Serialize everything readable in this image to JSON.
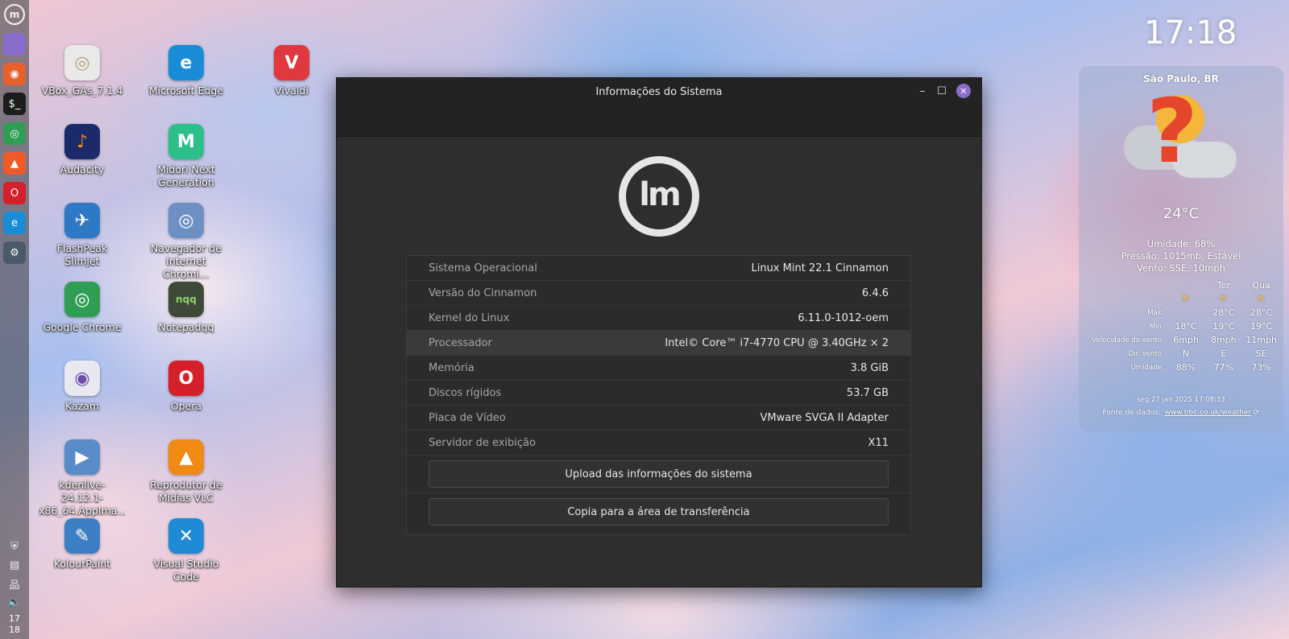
{
  "panel": {
    "apps": [
      {
        "name": "menu-button",
        "icon": "mint-menu-icon",
        "bg": "transparent",
        "glyph": "m"
      },
      {
        "name": "files-launcher",
        "icon": "folder-icon",
        "bg": "#8a6ccd",
        "glyph": ""
      },
      {
        "name": "firefox-launcher",
        "icon": "firefox-icon",
        "bg": "#e8612c",
        "glyph": "◉"
      },
      {
        "name": "terminal-launcher",
        "icon": "terminal-icon",
        "bg": "#1d1d1d",
        "glyph": "$_"
      },
      {
        "name": "chrome-launcher",
        "icon": "chrome-icon",
        "bg": "#2f9e54",
        "glyph": "◎"
      },
      {
        "name": "brave-launcher",
        "icon": "brave-icon",
        "bg": "#f05a28",
        "glyph": "▲"
      },
      {
        "name": "opera-launcher",
        "icon": "opera-icon",
        "bg": "#d51f2a",
        "glyph": "O"
      },
      {
        "name": "edge-launcher",
        "icon": "edge-icon",
        "bg": "#1a8bd6",
        "glyph": "e"
      },
      {
        "name": "settings-launcher",
        "icon": "gear-icon",
        "bg": "#4b5a6b",
        "glyph": "⚙"
      }
    ],
    "tray": [
      {
        "name": "shield-tray-icon",
        "glyph": "⛨"
      },
      {
        "name": "clipboard-tray-icon",
        "glyph": "▤"
      },
      {
        "name": "network-tray-icon",
        "glyph": "品"
      },
      {
        "name": "volume-tray-icon",
        "glyph": "🔈"
      }
    ],
    "clock_hour": "17",
    "clock_min": "18"
  },
  "desktop_icons": [
    {
      "label": "VBox_GAs_7.1.4",
      "icon": "disc-icon",
      "bg": "#e9e9e9",
      "color": "#b9a07a",
      "glyph": "◎"
    },
    {
      "label": "Microsoft Edge",
      "icon": "edge-icon",
      "bg": "#1a8bd6",
      "color": "#fff",
      "glyph": "e"
    },
    {
      "label": "Vivaldi",
      "icon": "vivaldi-icon",
      "bg": "#e0383e",
      "color": "#fff",
      "glyph": "V"
    },
    {
      "label": "Audacity",
      "icon": "audacity-icon",
      "bg": "#1b2a6b",
      "color": "#f28b1a",
      "glyph": "♪"
    },
    {
      "label": "Midori Next Generation",
      "icon": "midori-icon",
      "bg": "#2dbf8a",
      "color": "#fff",
      "glyph": "M"
    },
    {
      "label": "FlashPeak Slimjet",
      "icon": "slimjet-icon",
      "bg": "#2f78c4",
      "color": "#fff",
      "glyph": "✈"
    },
    {
      "label": "Navegador de Internet Chromi…",
      "icon": "chromium-icon",
      "bg": "#6d8fc4",
      "color": "#fff",
      "glyph": "◎"
    },
    {
      "label": "Google Chrome",
      "icon": "chrome-icon",
      "bg": "#2f9e54",
      "color": "#fff",
      "glyph": "◎"
    },
    {
      "label": "Notepadqq",
      "icon": "notepadqq-icon",
      "bg": "#3d4a3a",
      "color": "#8fd16a",
      "glyph": "nqq"
    },
    {
      "label": "Kazam",
      "icon": "kazam-icon",
      "bg": "#e8e8f0",
      "color": "#6d4fa8",
      "glyph": "◉"
    },
    {
      "label": "Opera",
      "icon": "opera-icon",
      "bg": "#d51f2a",
      "color": "#fff",
      "glyph": "O"
    },
    {
      "label": "kdenlive-24.12.1-x86_64.AppIma…",
      "icon": "kdenlive-icon",
      "bg": "#5a8ac8",
      "color": "#fff",
      "glyph": "▶"
    },
    {
      "label": "Reprodutor de Mídias VLC",
      "icon": "vlc-icon",
      "bg": "#f08a14",
      "color": "#fff",
      "glyph": "▲"
    },
    {
      "label": "KolourPaint",
      "icon": "kolourpaint-icon",
      "bg": "#3d7fc4",
      "color": "#fff",
      "glyph": "✎"
    },
    {
      "label": "Visual Studio Code",
      "icon": "vscode-icon",
      "bg": "#1f8ad6",
      "color": "#fff",
      "glyph": "✕"
    }
  ],
  "window": {
    "title": "Informações do Sistema",
    "rows": [
      {
        "key": "Sistema Operacional",
        "value": "Linux Mint 22.1 Cinnamon"
      },
      {
        "key": "Versão do Cinnamon",
        "value": "6.4.6"
      },
      {
        "key": "Kernel do Linux",
        "value": "6.11.0-1012-oem"
      },
      {
        "key": "Processador",
        "value": "Intel© Core™ i7-4770 CPU @ 3.40GHz × 2"
      },
      {
        "key": "Memória",
        "value": "3.8 GiB"
      },
      {
        "key": "Discos rígidos",
        "value": "53.7 GB"
      },
      {
        "key": "Placa de Vídeo",
        "value": "VMware SVGA II Adapter"
      },
      {
        "key": "Servidor de exibição",
        "value": "X11"
      }
    ],
    "upload_label": "Upload das informações do sistema",
    "copy_label": "Copia para a área de transferência"
  },
  "clock": {
    "time": "17:18"
  },
  "weather": {
    "city": "São Paulo, BR",
    "temp": "24°C",
    "humidity": "Umidade: 68%",
    "pressure": "Pressão: 1015mb, Estável",
    "wind": "Vento: SSE, 10mph",
    "days": [
      "",
      "Ter",
      "Qua"
    ],
    "rows": [
      {
        "label": "Máx:",
        "values": [
          "",
          "28°C",
          "28°C"
        ]
      },
      {
        "label": "Mín:",
        "values": [
          "18°C",
          "19°C",
          "19°C"
        ]
      },
      {
        "label": "Velocidade do vento:",
        "values": [
          "6mph",
          "8mph",
          "11mph"
        ]
      },
      {
        "label": "Dir. vento:",
        "values": [
          "N",
          "E",
          "SE"
        ]
      },
      {
        "label": "Umidade:",
        "values": [
          "88%",
          "77%",
          "73%"
        ]
      }
    ],
    "updated": "seg 27 jan 2025 17:08:33",
    "source_label": "Fonte de dados:",
    "source_link": "www.bbc.co.uk/weather"
  }
}
